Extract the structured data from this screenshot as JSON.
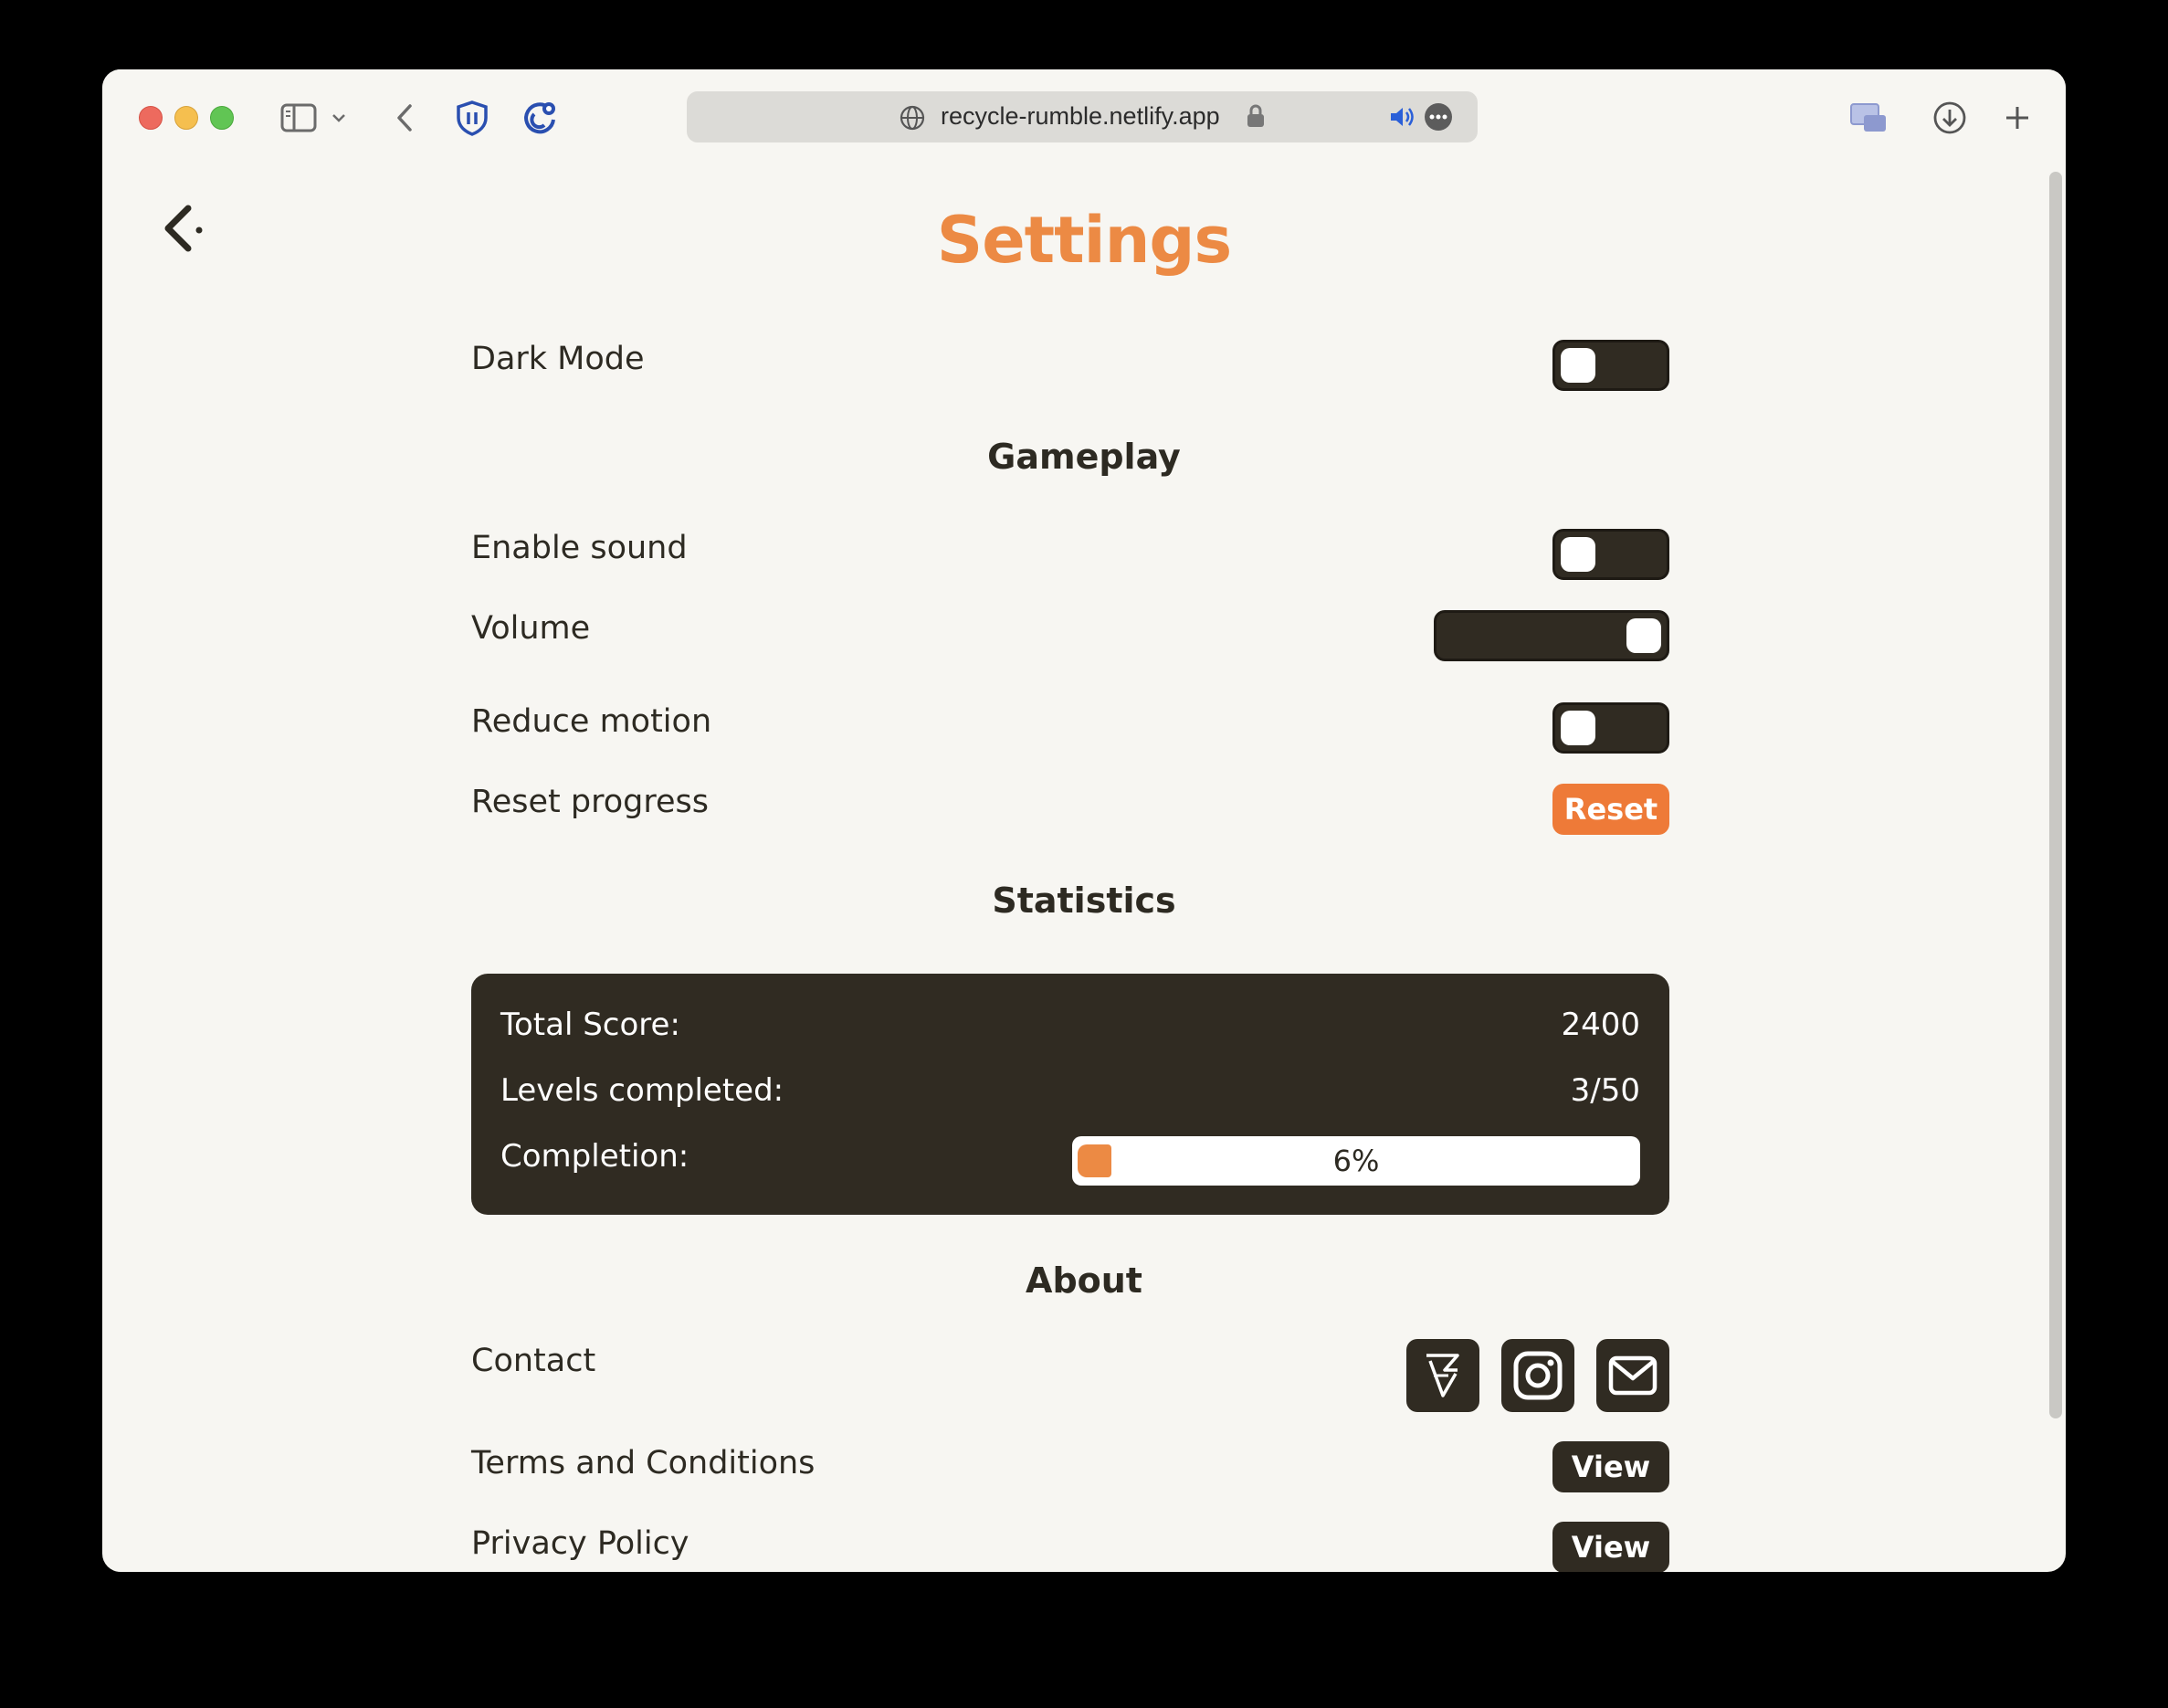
{
  "browser": {
    "url": "recycle-rumble.netlify.app",
    "icons": [
      "sidebar-icon",
      "chevron-down-icon",
      "back-arrow-icon",
      "shield-icon",
      "tracker-icon",
      "globe-icon",
      "lock-icon",
      "speaker-icon",
      "more-icon",
      "picture-in-picture-icon",
      "download-icon",
      "new-tab-icon"
    ]
  },
  "page": {
    "title": "Settings",
    "back_icon": "back-arrow-icon"
  },
  "settings": {
    "dark_mode_label": "Dark Mode",
    "dark_mode_on": false,
    "gameplay_title": "Gameplay",
    "enable_sound_label": "Enable sound",
    "enable_sound_on": false,
    "volume_label": "Volume",
    "volume_level": 1.0,
    "reduce_motion_label": "Reduce motion",
    "reduce_motion_on": false,
    "reset_progress_label": "Reset progress",
    "reset_button": "Reset"
  },
  "statistics": {
    "title": "Statistics",
    "total_score_label": "Total Score:",
    "total_score_value": "2400",
    "levels_label": "Levels completed:",
    "levels_value": "3/50",
    "completion_label": "Completion:",
    "completion_text": "6%",
    "completion_fraction": 0.06
  },
  "about": {
    "title": "About",
    "contact_label": "Contact",
    "social_icons": [
      "itch-icon",
      "instagram-icon",
      "mail-icon"
    ],
    "terms_label": "Terms and Conditions",
    "terms_button": "View",
    "privacy_label": "Privacy Policy",
    "privacy_button": "View"
  },
  "colors": {
    "accent": "#ec8a44",
    "reset": "#ee7a38",
    "dark": "#302b22",
    "background": "#f7f6f2"
  }
}
